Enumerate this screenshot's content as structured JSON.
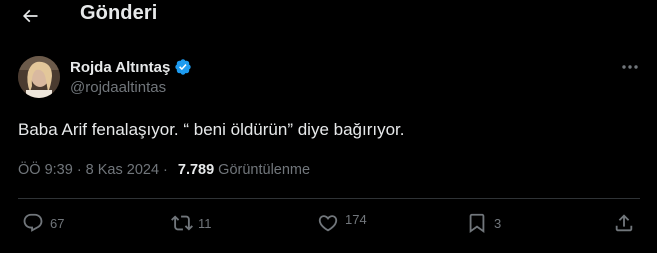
{
  "header": {
    "title": "Gönderi",
    "back_icon": "arrow-left-icon"
  },
  "author": {
    "display_name": "Rojda Altıntaş",
    "handle": "@rojdaaltintas",
    "verified": true,
    "verified_color": "#1d9bf0"
  },
  "tweet": {
    "text": "Baba Arif fenalaşıyor. “ beni öldürün” diye bağırıyor.",
    "time": "ÖÖ 9:39",
    "separator": "·",
    "date": "8 Kas 2024",
    "views_count": "7.789",
    "views_label": "Görüntülenme"
  },
  "actions": {
    "reply_count": "67",
    "retweet_count": "11",
    "like_count": "174",
    "bookmark_count": "3"
  },
  "colors": {
    "background": "#000000",
    "text": "#e7e9ea",
    "muted": "#71767b",
    "divider": "#2f3336"
  }
}
